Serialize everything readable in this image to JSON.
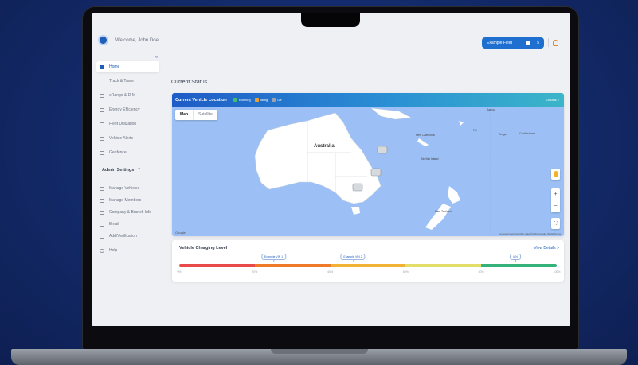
{
  "header": {
    "welcome_text": "Welcome, John Doe!",
    "fleet_button_label": "Example Fleet",
    "fleet_count": "5"
  },
  "sidebar": {
    "items": [
      {
        "label": "Home",
        "icon": "home-icon"
      },
      {
        "label": "Track & Trace",
        "icon": "crosshair-icon"
      },
      {
        "label": "eRange & D-M",
        "icon": "range-icon"
      },
      {
        "label": "Energy Efficiency",
        "icon": "battery-icon"
      },
      {
        "label": "Fleet Utilization",
        "icon": "chart-icon"
      },
      {
        "label": "Vehicle Alerts",
        "icon": "bell-icon"
      },
      {
        "label": "Geofence",
        "icon": "map-icon"
      }
    ],
    "admin_heading": "Admin Settings",
    "admin_items": [
      {
        "label": "Manage Vehicles",
        "icon": "car-icon"
      },
      {
        "label": "Manage Members",
        "icon": "users-icon"
      },
      {
        "label": "Company & Branch Info",
        "icon": "building-icon"
      },
      {
        "label": "Email",
        "icon": "mail-icon"
      },
      {
        "label": "Add/Verification",
        "icon": "verify-icon"
      }
    ],
    "help_label": "Help"
  },
  "main": {
    "title": "Current Status"
  },
  "map_card": {
    "title": "Current Vehicle Location",
    "legend": [
      {
        "label": "Running",
        "color": "#3fbf6e"
      },
      {
        "label": "Idling",
        "color": "#f0a030"
      },
      {
        "label": "Off",
        "color": "#9aa3b0"
      }
    ],
    "details_link": "Details >",
    "toggle_map": "Map",
    "toggle_satellite": "Satellite",
    "labels": {
      "australia": "Australia",
      "new_zealand": "New Zealand",
      "new_caledonia": "New Caledonia",
      "fiji": "Fiji",
      "tonga": "Tonga",
      "cook_islands": "Cook Islands",
      "norfolk_island": "Norfolk Island",
      "samoa": "Samoa"
    },
    "google": "Google",
    "attribution": "Keyboard shortcuts   Map data ©2024 Google, INEGI   Terms"
  },
  "charge_card": {
    "title": "Vehicle Charging Level",
    "details_link": "View Details >",
    "segments": [
      {
        "from": 0,
        "to": 20,
        "color": "#e84a4a"
      },
      {
        "from": 20,
        "to": 40,
        "color": "#ee7a2a"
      },
      {
        "from": 40,
        "to": 60,
        "color": "#f2b233"
      },
      {
        "from": 60,
        "to": 80,
        "color": "#e3dd6a"
      },
      {
        "from": 80,
        "to": 100,
        "color": "#34b27a"
      }
    ],
    "ticks": [
      "0%",
      "20%",
      "40%",
      "60%",
      "80%",
      "100%"
    ],
    "markers": [
      {
        "label": "Example VIN 1",
        "percent": 25
      },
      {
        "label": "Example VIN 2",
        "percent": 46
      },
      {
        "label": "VIN",
        "percent": 89
      }
    ]
  }
}
